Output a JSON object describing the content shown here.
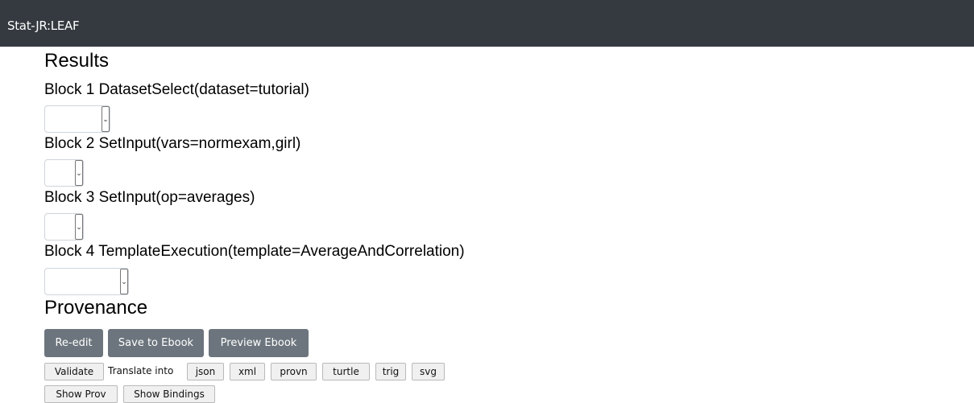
{
  "navbar": {
    "brand": "Stat-JR:LEAF"
  },
  "results": {
    "heading": "Results",
    "blocks": [
      {
        "label": "Block 1 DatasetSelect(dataset=tutorial)",
        "selected_value": ""
      },
      {
        "label": "Block 2 SetInput(vars=normexam,girl)",
        "selected_value": ""
      },
      {
        "label": "Block 3 SetInput(op=averages)",
        "selected_value": ""
      },
      {
        "label": "Block 4 TemplateExecution(template=AverageAndCorrelation)",
        "selected_value": ""
      }
    ]
  },
  "provenance": {
    "heading": "Provenance",
    "buttons": {
      "reedit": "Re-edit",
      "save_ebook": "Save to Ebook",
      "preview_ebook": "Preview Ebook"
    },
    "validate": "Validate",
    "translate_into": "Translate into",
    "formats": [
      "json",
      "xml",
      "provn",
      "turtle",
      "trig",
      "svg"
    ],
    "show_prov": "Show Prov",
    "show_bindings": "Show Bindings"
  },
  "colors": {
    "navbar": "#343a40",
    "dark_button": "#6c757d",
    "light_button": "#f0f0f0"
  },
  "icons": {
    "select_arrow": "chevron-down-icon"
  }
}
